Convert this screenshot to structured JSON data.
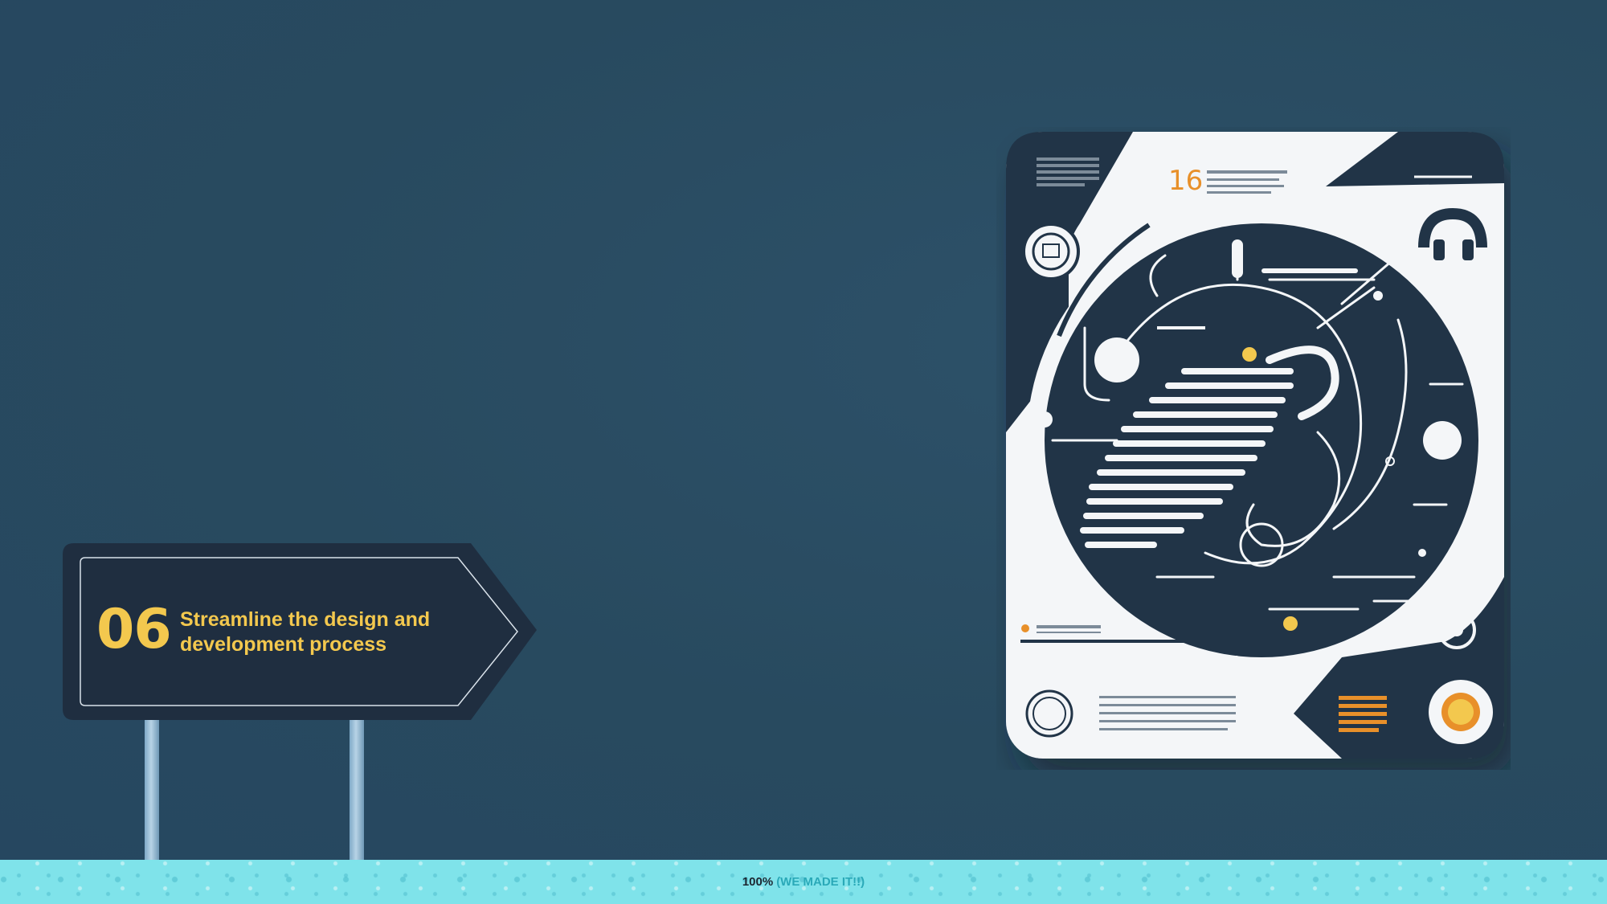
{
  "sign": {
    "number": "06",
    "text": "Streamline the design and development process"
  },
  "illustration": {
    "number_badge": "16"
  },
  "progress": {
    "value_percent": 100,
    "label": "100%",
    "note": "(WE MADE IT!!)"
  },
  "colors": {
    "background": "#284a5f",
    "sign_background": "#1f2e40",
    "accent_yellow": "#f3c84e",
    "accent_orange": "#e8902a",
    "progress_bar": "#82e7ec"
  }
}
